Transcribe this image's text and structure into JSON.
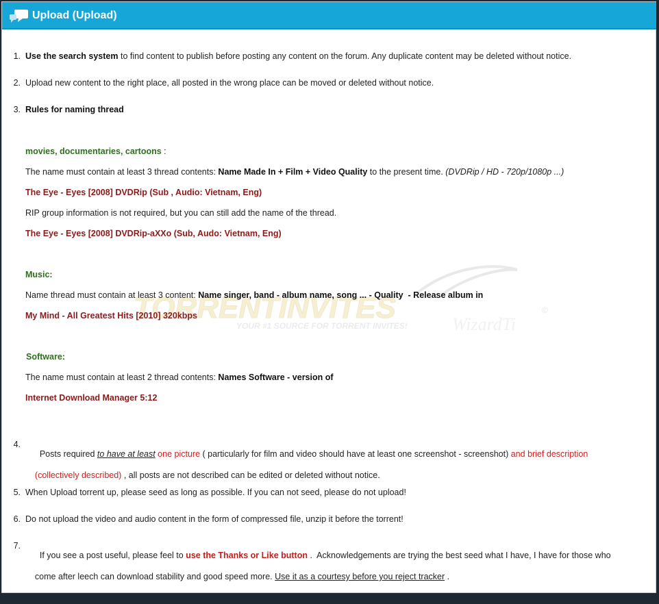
{
  "header": {
    "title": "Upload (Upload)",
    "icon": "speech-bubbles-icon"
  },
  "colors": {
    "header_bg": "#16a6d7",
    "green": "#2f6e1e",
    "dark_red": "#8b1a1a",
    "red": "#d02020"
  },
  "watermark": {
    "brand": "TORRENTINVITES",
    "tagline": "YOUR #1 SOURCE FOR TORRENT INVITES!",
    "signature": "WizardTi",
    "copyright": "©"
  },
  "rules": {
    "r1": {
      "num": "1.",
      "bold": "Use the search system",
      "text": " to find content to publish before posting any content on the forum. Any duplicate content may be deleted without notice."
    },
    "r2": {
      "num": "2.",
      "text": "Upload new content to the right place, all posted in the wrong place can be moved or deleted without notice."
    },
    "r3": {
      "num": "3.",
      "title": "Rules for naming thread",
      "movies": {
        "heading": "movies, documentaries, cartoons",
        "heading_suffix": " :",
        "line1_pre": "The name must contain at least 3 thread contents: ",
        "line1_bold": "Name Made In + Film + Video Quality",
        "line1_mid": " to the present time. ",
        "line1_italic": "(DVDRip / HD - 720p/1080p ...)",
        "example1": "The Eye - Eyes [2008] DVDRip (Sub , Audio: Vietnam, Eng)",
        "line2": "RIP group information is not required, but you can still add the name of the thread.",
        "example2": "The Eye - Eyes [2008] DVDRip-aXXo (Sub, Audo: Vietnam, Eng)"
      },
      "music": {
        "heading": "Music:",
        "line_pre": "Name thread must contain at least 3 content: ",
        "line_bold": "Name singer, band - album name, song ... - Quality  - Release album in",
        "example": "My Mind - All Greatest Hits [2010] 320kbps"
      },
      "software": {
        "heading": "Software:",
        "line_pre": "The name must contain at least 2 thread contents: ",
        "line_bold": "Names Software - version of",
        "example": "Internet Download Manager 5:12"
      }
    },
    "r4": {
      "num": "4.",
      "pre": "Posts required ",
      "underlined": "to have at least",
      "red1": " one picture",
      "mid": " ( particularly for film and video should have at least one screenshot - screenshot) ",
      "red2": "and brief description",
      "red3": "(collectively described)",
      "rest": " , all posts are not described can be edited or deleted without notice."
    },
    "r5": {
      "num": "5.",
      "text": "When Upload torrent up, please seed as long as possible. If you can not seed, please do not upload!"
    },
    "r6": {
      "num": "6.",
      "text": "Do not upload the video and audio content in the form of compressed file, unzip it before the torrent!"
    },
    "r7": {
      "num": "7.",
      "pre": "If you see a post useful, please feel to ",
      "redbold": "use the Thanks or Like button",
      "mid": " .  Acknowledgements are trying the best seed what I have, I have for those who",
      "line2_pre": "come after leech can download stability and good speed more. ",
      "line2_underlined": "Use it as a courtesy before you reject tracker",
      "line2_end": " ."
    }
  }
}
